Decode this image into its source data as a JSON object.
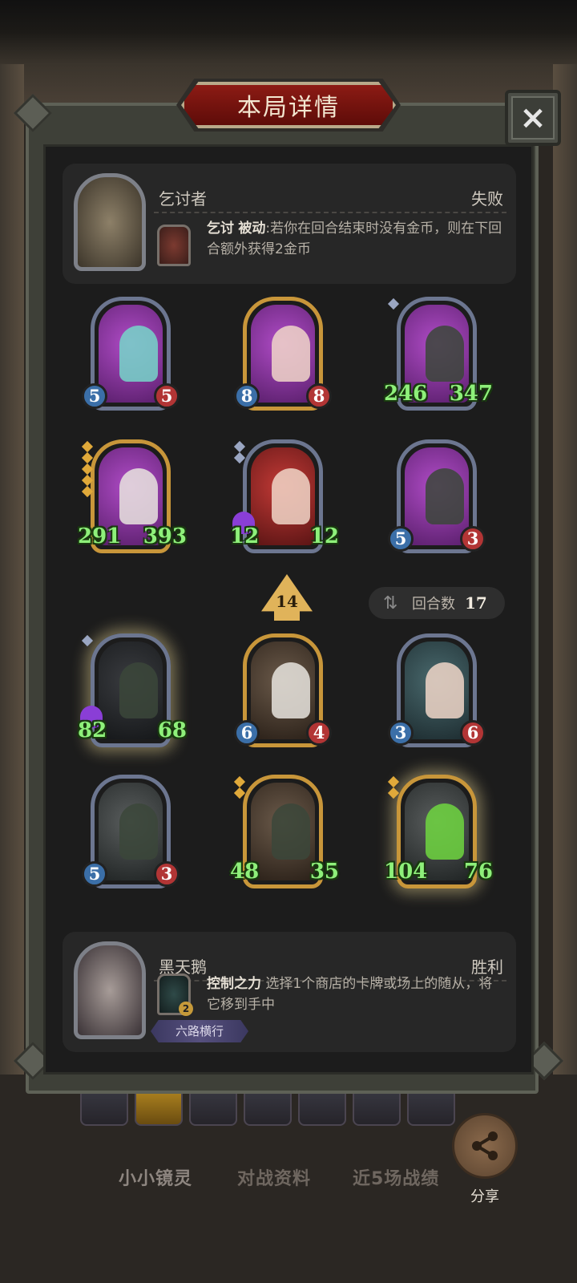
{
  "title": "本局详情",
  "close_icon": "×",
  "opponent": {
    "name": "乞讨者",
    "result": "失败",
    "skill_name": "乞讨",
    "skill_type": "被动",
    "skill_desc": ":若你在回合结束时没有金币，则在下回合额外获得2金币"
  },
  "opponent_board": [
    {
      "atk": "5",
      "hp": "5"
    },
    {
      "atk": "8",
      "hp": "8"
    },
    {
      "atk": "246",
      "hp": "347"
    },
    {
      "atk": "291",
      "hp": "393"
    },
    {
      "atk": "12",
      "hp": "12"
    },
    {
      "atk": "5",
      "hp": "3"
    }
  ],
  "level": "14",
  "round": {
    "label": "回合数",
    "value": "17",
    "icon": "swap-icon"
  },
  "player_board": [
    {
      "atk": "82",
      "hp": "68"
    },
    {
      "atk": "6",
      "hp": "4"
    },
    {
      "atk": "3",
      "hp": "6"
    },
    {
      "atk": "5",
      "hp": "3"
    },
    {
      "atk": "48",
      "hp": "35"
    },
    {
      "atk": "104",
      "hp": "76"
    }
  ],
  "player": {
    "name": "黑天鹅",
    "result": "胜利",
    "skill_name": "控制之力",
    "skill_desc": " 选择1个商店的卡牌或场上的随从，将它移到手中",
    "skill_badge": "2",
    "trait": "六路横行"
  },
  "bottom_tabs": [
    "小小镜灵",
    "对战资料",
    "近5场战绩"
  ],
  "share_label": "分享"
}
